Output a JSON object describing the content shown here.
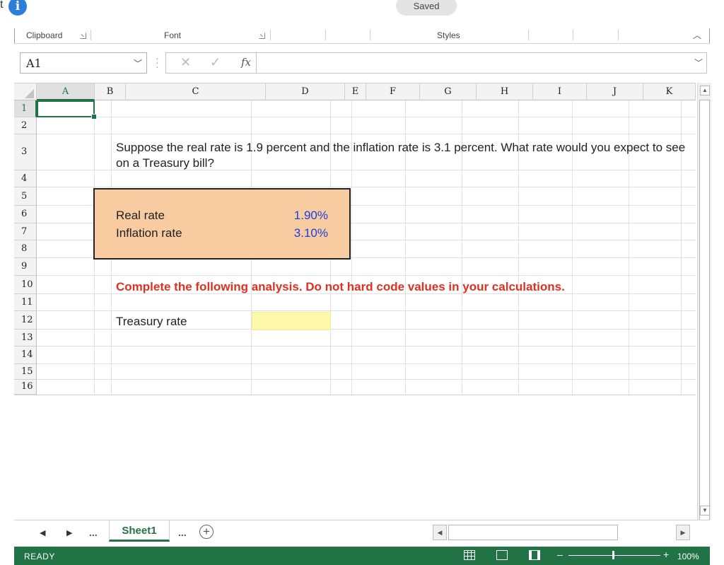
{
  "topbar": {
    "left_text": "t",
    "status": "Saved"
  },
  "ribbon": {
    "groups": [
      "Clipboard",
      "Font",
      "Styles"
    ]
  },
  "formula_bar": {
    "name_box": "A1",
    "cancel_glyph": "✕",
    "enter_glyph": "✓",
    "fx_label": "fx",
    "formula": ""
  },
  "columns": [
    "A",
    "B",
    "C",
    "D",
    "E",
    "F",
    "G",
    "H",
    "I",
    "J",
    "K"
  ],
  "rows": [
    "1",
    "2",
    "3",
    "4",
    "5",
    "6",
    "7",
    "8",
    "9",
    "10",
    "11",
    "12",
    "13",
    "14",
    "15",
    "16"
  ],
  "cells": {
    "question": "Suppose the real rate is 1.9 percent and the inflation rate is 3.1 percent. What rate would you expect to see on a Treasury bill?",
    "real_rate_label": "Real rate",
    "real_rate_value": "1.90%",
    "inflation_rate_label": "Inflation rate",
    "inflation_rate_value": "3.10%",
    "instruction": "Complete the following analysis. Do not hard code values in your calculations.",
    "treasury_rate_label": "Treasury rate",
    "treasury_rate_value": ""
  },
  "sheets": {
    "more": "...",
    "active": "Sheet1",
    "add": "+"
  },
  "status": {
    "mode": "READY",
    "zoom": "100%"
  },
  "colors": {
    "accent": "#217346",
    "input_fill": "#f8cba0",
    "answer_fill": "#fdf7a8",
    "input_value": "#1a3fe0",
    "instruction": "#e03020"
  }
}
